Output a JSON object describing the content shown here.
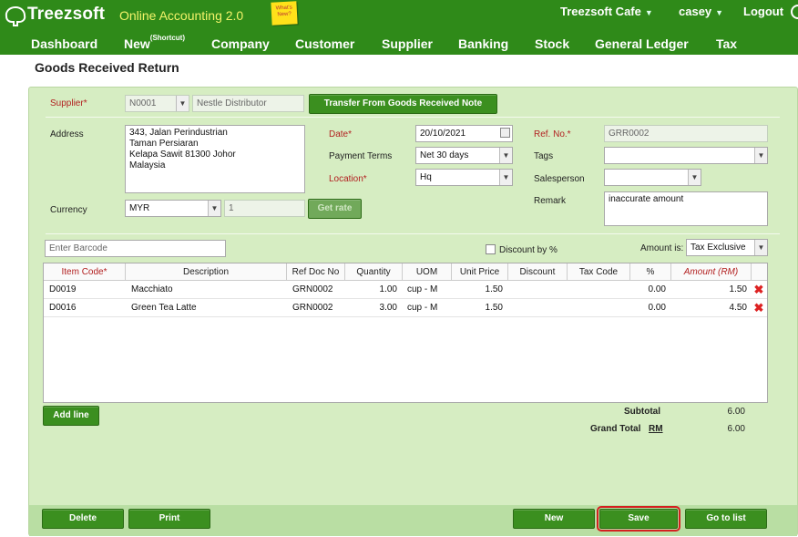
{
  "app": {
    "logo": "Treezsoft",
    "tagline": "Online Accounting 2.0",
    "note": "What's New?",
    "company": "Treezsoft Cafe",
    "user": "casey",
    "logout": "Logout"
  },
  "nav": {
    "items": [
      "Dashboard",
      "New",
      "Company",
      "Customer",
      "Supplier",
      "Banking",
      "Stock",
      "General Ledger",
      "Tax"
    ],
    "shortcut_sup": "(Shortcut)"
  },
  "page": {
    "title": "Goods Received Return"
  },
  "form": {
    "supplier_label": "Supplier*",
    "supplier_code": "N0001",
    "supplier_name": "Nestle Distributor",
    "transfer_button": "Transfer From Goods Received Note",
    "address_label": "Address",
    "address_lines": [
      "343, Jalan Perindustrian",
      "Taman Persiaran",
      "Kelapa Sawit 81300 Johor",
      "Malaysia"
    ],
    "currency_label": "Currency",
    "currency": "MYR",
    "currency_rate": "1",
    "get_rate_button": "Get rate",
    "date_label": "Date*",
    "date": "20/10/2021",
    "payment_terms_label": "Payment Terms",
    "payment_terms": "Net 30 days",
    "location_label": "Location*",
    "location": "Hq",
    "ref_label": "Ref. No.*",
    "ref": "GRR0002",
    "tags_label": "Tags",
    "tags": "",
    "salesperson_label": "Salesperson",
    "salesperson": "",
    "remark_label": "Remark",
    "remark": "inaccurate amount",
    "barcode_placeholder": "Enter Barcode",
    "discount_label": "Discount by %",
    "amount_is_label": "Amount is:",
    "amount_is": "Tax Exclusive"
  },
  "table": {
    "headers": [
      "Item Code*",
      "Description",
      "Ref Doc No",
      "Quantity",
      "UOM",
      "Unit Price",
      "Discount",
      "Tax Code",
      "%",
      "Amount (RM)"
    ],
    "rows": [
      {
        "code": "D0019",
        "desc": "Macchiato",
        "ref": "GRN0002",
        "qty": "1.00",
        "uom": "cup - M",
        "price": "1.50",
        "discount": "",
        "tax": "",
        "pct": "0.00",
        "amount": "1.50"
      },
      {
        "code": "D0016",
        "desc": "Green Tea Latte",
        "ref": "GRN0002",
        "qty": "3.00",
        "uom": "cup - M",
        "price": "1.50",
        "discount": "",
        "tax": "",
        "pct": "0.00",
        "amount": "4.50"
      }
    ],
    "add_line": "Add line"
  },
  "totals": {
    "subtotal_label": "Subtotal",
    "subtotal": "6.00",
    "grand_total_label": "Grand Total",
    "currency_symbol": "RM",
    "grand_total": "6.00"
  },
  "actions": {
    "delete": "Delete",
    "print": "Print",
    "new": "New",
    "save": "Save",
    "go_to_list": "Go to list"
  },
  "colors": {
    "brand": "#2f8a19",
    "panel": "#d6edc2",
    "required": "#b22020",
    "highlight": "#d42020"
  }
}
